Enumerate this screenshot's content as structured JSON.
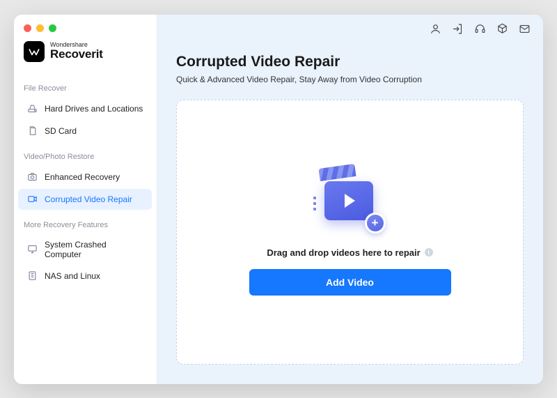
{
  "brand": {
    "top": "Wondershare",
    "bottom": "Recoverit"
  },
  "sidebar": {
    "sections": [
      {
        "title": "File Recover",
        "items": [
          {
            "label": "Hard Drives and Locations",
            "icon": "drive"
          },
          {
            "label": "SD Card",
            "icon": "sd"
          }
        ]
      },
      {
        "title": "Video/Photo Restore",
        "items": [
          {
            "label": "Enhanced Recovery",
            "icon": "camera"
          },
          {
            "label": "Corrupted Video Repair",
            "icon": "video",
            "active": true
          }
        ]
      },
      {
        "title": "More Recovery Features",
        "items": [
          {
            "label": "System Crashed Computer",
            "icon": "monitor"
          },
          {
            "label": "NAS and Linux",
            "icon": "nas"
          }
        ]
      }
    ]
  },
  "page": {
    "title": "Corrupted Video Repair",
    "subtitle": "Quick & Advanced Video Repair, Stay Away from Video Corruption",
    "drop_label": "Drag and drop videos here to repair",
    "add_button": "Add Video"
  },
  "top_icons": [
    "user",
    "login",
    "headset",
    "cube",
    "mail"
  ]
}
